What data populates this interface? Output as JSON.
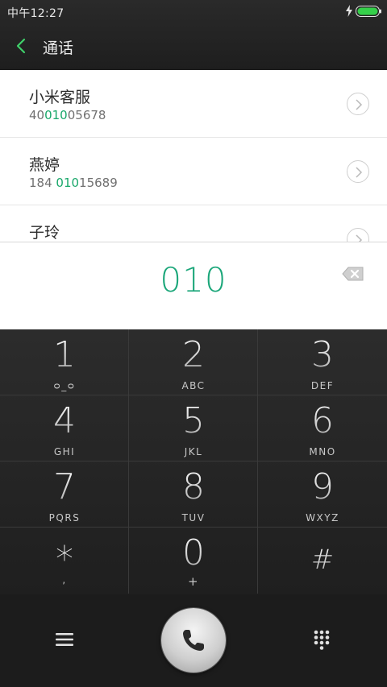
{
  "status_bar": {
    "time": "中午12:27"
  },
  "header": {
    "title": "通话"
  },
  "contacts": [
    {
      "name": "小米客服",
      "number_pre": "40",
      "number_match": "010",
      "number_post": "05678"
    },
    {
      "name": "燕婷",
      "number_pre": "184 ",
      "number_match": "010",
      "number_post": "15689"
    },
    {
      "name": "子玲",
      "number_pre": "",
      "number_match": "",
      "number_post": ""
    }
  ],
  "dialed_number": "010",
  "keypad": [
    {
      "digit": "1",
      "letters": "ᴑ_ᴑ"
    },
    {
      "digit": "2",
      "letters": "ABC"
    },
    {
      "digit": "3",
      "letters": "DEF"
    },
    {
      "digit": "4",
      "letters": "GHI"
    },
    {
      "digit": "5",
      "letters": "JKL"
    },
    {
      "digit": "6",
      "letters": "MNO"
    },
    {
      "digit": "7",
      "letters": "PQRS"
    },
    {
      "digit": "8",
      "letters": "TUV"
    },
    {
      "digit": "9",
      "letters": "WXYZ"
    },
    {
      "digit": "*",
      "letters": ","
    },
    {
      "digit": "0",
      "letters": "+"
    },
    {
      "digit": "#",
      "letters": ""
    }
  ],
  "colors": {
    "accent": "#1aa86b",
    "battery": "#35d04a"
  },
  "icons": {
    "back": "chevron-left-icon",
    "backspace": "backspace-icon",
    "menu": "menu-icon",
    "call": "phone-icon",
    "dialpad": "dialpad-icon"
  }
}
